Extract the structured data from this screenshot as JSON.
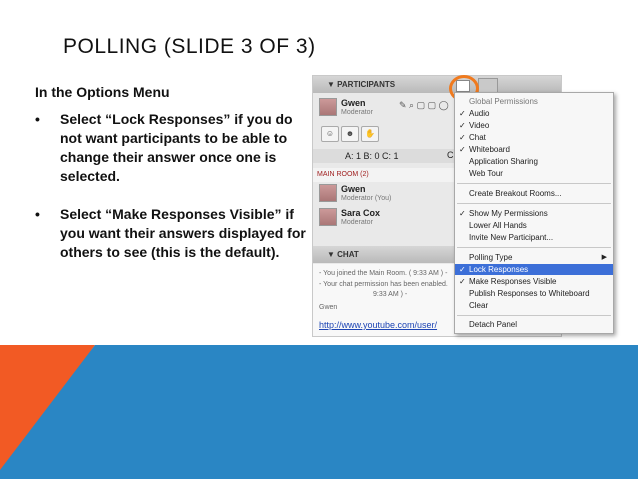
{
  "slide": {
    "title": "POLLING (SLIDE 3 OF 3)",
    "intro": "In the Options Menu",
    "bullets": [
      {
        "marker": "•",
        "text": "Select “Lock Responses” if you do not want participants to be able to change their answer once one is selected."
      },
      {
        "marker": "•",
        "text": "Select “Make Responses Visible” if you want their answers displayed for others to see (this is the default)."
      }
    ]
  },
  "screenshot": {
    "participants_header": "▼ PARTICIPANTS",
    "moderator": {
      "name": "Gwen",
      "role": "Moderator"
    },
    "poll_counts": "A: 1   B: 0   C: 1",
    "cl_label": "Cl",
    "main_room_label": "MAIN ROOM (2)",
    "members": [
      {
        "name": "Gwen",
        "role": "Moderator (You)"
      },
      {
        "name": "Sara Cox",
        "role": "Moderator"
      }
    ],
    "chat_header": "▼ CHAT",
    "chat_lines": [
      "- You joined the Main Room. ( 9:33 AM ) -",
      "- Your chat permission has been enabled.",
      "9:33 AM ) -",
      "Gwen"
    ],
    "chat_link": "http://www.youtube.com/user/",
    "menu": {
      "items": [
        {
          "check": "",
          "label": "Global Permissions",
          "kind": "header"
        },
        {
          "check": "✓",
          "label": "Audio"
        },
        {
          "check": "✓",
          "label": "Video"
        },
        {
          "check": "✓",
          "label": "Chat"
        },
        {
          "check": "✓",
          "label": "Whiteboard"
        },
        {
          "check": "",
          "label": "Application Sharing"
        },
        {
          "check": "",
          "label": "Web Tour"
        },
        {
          "check": "",
          "label": "Create Breakout Rooms..."
        },
        {
          "check": "✓",
          "label": "Show My Permissions"
        },
        {
          "check": "",
          "label": "Lower All Hands"
        },
        {
          "check": "",
          "label": "Invite New Participant..."
        },
        {
          "check": "",
          "label": "Polling Type",
          "arrow": "▶"
        },
        {
          "check": "✓",
          "label": "Lock Responses",
          "selected": true
        },
        {
          "check": "✓",
          "label": "Make Responses Visible"
        },
        {
          "check": "",
          "label": "Publish Responses to Whiteboard"
        },
        {
          "check": "",
          "label": "Clear"
        },
        {
          "check": "",
          "label": "Detach Panel"
        }
      ]
    }
  },
  "colors": {
    "blue_shape": "#2a86c4",
    "orange_shape": "#f25a24",
    "highlight_ring": "#f07a1e",
    "menu_selected": "#3c6fd8"
  }
}
